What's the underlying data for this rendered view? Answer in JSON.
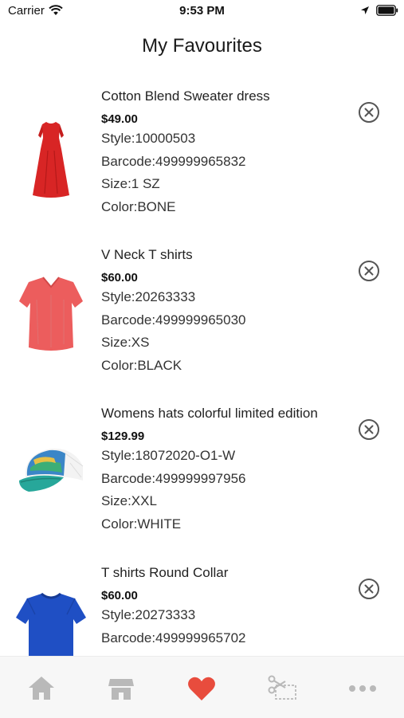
{
  "status_bar": {
    "carrier": "Carrier",
    "time": "9:53 PM"
  },
  "header": {
    "title": "My Favourites"
  },
  "colors": {
    "accent": "#e84c3d",
    "tab_inactive": "#b9b9b9"
  },
  "favourites": [
    {
      "name": "Cotton Blend Sweater dress",
      "price": "$49.00",
      "style": "Style:10000503",
      "barcode": "Barcode:499999965832",
      "size": "Size:1 SZ",
      "color": "Color:BONE",
      "image": "red-dress"
    },
    {
      "name": "V Neck T shirts",
      "price": "$60.00",
      "style": "Style:20263333",
      "barcode": "Barcode:499999965030",
      "size": "Size:XS",
      "color": "Color:BLACK",
      "image": "coral-tshirt"
    },
    {
      "name": "Womens hats colorful limited edition",
      "price": "$129.99",
      "style": "Style:18072020-O1-W",
      "barcode": "Barcode:499999997956",
      "size": "Size:XXL",
      "color": "Color:WHITE",
      "image": "colorful-cap"
    },
    {
      "name": "T shirts Round Collar",
      "price": "$60.00",
      "style": "Style:20273333",
      "barcode": "Barcode:499999965702",
      "image": "blue-tshirt"
    }
  ],
  "tab_bar": {
    "items": [
      {
        "icon": "home-icon",
        "active": false
      },
      {
        "icon": "store-icon",
        "active": false
      },
      {
        "icon": "heart-icon",
        "active": true
      },
      {
        "icon": "coupon-scissors-icon",
        "active": false
      },
      {
        "icon": "more-icon",
        "active": false
      }
    ]
  }
}
